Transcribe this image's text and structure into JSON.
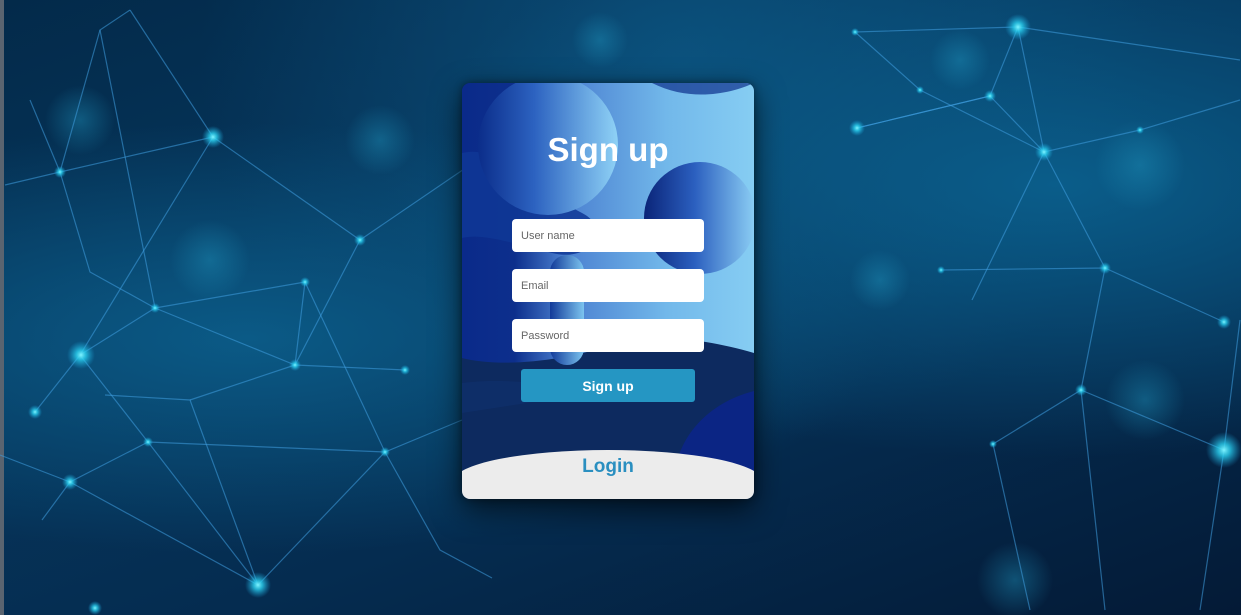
{
  "signup_form": {
    "title": "Sign up",
    "username_placeholder": "User name",
    "email_placeholder": "Email",
    "password_placeholder": "Password",
    "submit_label": "Sign up"
  },
  "login_panel": {
    "link_label": "Login"
  },
  "colors": {
    "accent": "#2596c3",
    "login_text": "#2a8fc0",
    "card_dark": "#0c2d66",
    "panel_background": "#ececec"
  }
}
